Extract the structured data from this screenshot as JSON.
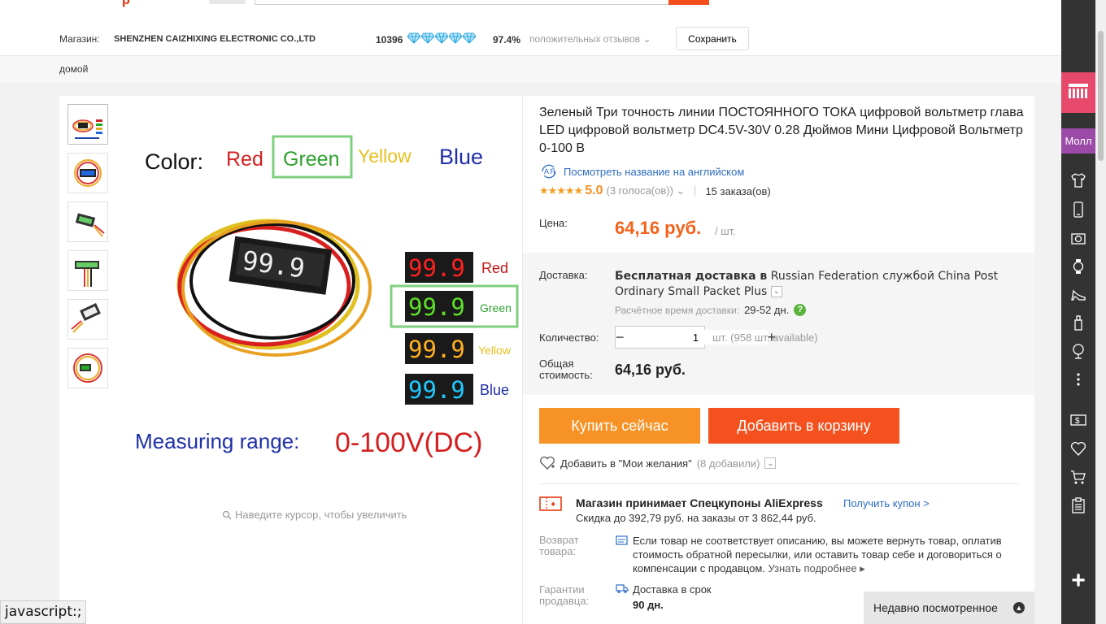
{
  "header": {
    "logo_fragment": "р"
  },
  "store": {
    "label": "Магазин:",
    "name": "SHENZHEN CAIZHIXING ELECTRONIC CO.,LTD",
    "score": "10396",
    "positive_percent": "97.4%",
    "feedback_label": "положительных отзывов",
    "save_label": "Сохранить",
    "diamond_count": 5,
    "diamond_color": "#2aa8e0"
  },
  "breadcrumb": {
    "home": "домой"
  },
  "gallery": {
    "thumbnails": [
      "thumb-1",
      "thumb-2",
      "thumb-3",
      "thumb-4",
      "thumb-5",
      "thumb-6"
    ],
    "image": {
      "color_label": "Color:",
      "colors": [
        "Red",
        "Green",
        "Yellow",
        "Blue"
      ],
      "display_digits": "99.9",
      "range_label": "Measuring range:",
      "range_value": "0-100V(DC)"
    },
    "zoom_hint": "Наведите курсор, чтобы увеличить"
  },
  "product": {
    "title": "Зеленый Три точность линии ПОСТОЯННОГО ТОКА цифровой вольтметр глава LED цифровой вольтметр DC4.5V-30V 0.28 Дюймов Мини Цифровой Вольтметр 0-100 В",
    "translate_link": "Посмотреть название на английском",
    "rating_value": "5.0",
    "rating_stars": "★★★★★",
    "votes": "(3 голоса(ов))",
    "orders": "15 заказа(ов)",
    "price_label": "Цена:",
    "price": "64,16 руб.",
    "price_unit": "/ шт."
  },
  "shipping": {
    "label": "Доставка:",
    "text_bold": "Бесплатная доставка в",
    "text_rest": "Russian Federation службой China Post Ordinary Small Packet Plus",
    "est_label": "Расчётное время доставки:",
    "est_value": "29-52 дн.",
    "qty_label": "Количество:",
    "qty_minus": "−",
    "qty_value": "1",
    "qty_plus": "+",
    "available": "шт. (958 шт. available)",
    "total_label": "Общая стоимость:",
    "total_value": "64,16 руб."
  },
  "actions": {
    "buy_now": "Купить сейчас",
    "add_to_cart": "Добавить в корзину",
    "wishlist": "Добавить в \"Мои желания\"",
    "wishlist_count": "(8 добавили)"
  },
  "coupon": {
    "title": "Магазин принимает Спецкупоны AliExpress",
    "link": "Получить купон >",
    "subtitle": "Скидка до 392,79 руб. на заказы от 3 862,44 руб."
  },
  "returns": {
    "label": "Возврат товара:",
    "text": "Если товар не соответствует описанию, вы можете вернуть товар, оплатив стоимость обратной пересылки, или оставить товар себе и договориться о компенсации с продавцом.",
    "more": "Узнать подробнее ▸"
  },
  "guarantee": {
    "label": "Гарантии продавца:",
    "text": "Доставка в срок",
    "days": "90 дн."
  },
  "recently_viewed": {
    "label": "Недавно посмотренное"
  },
  "status_bar": {
    "text": "javascript:;"
  },
  "sidebar": {
    "mall_label": "Молл",
    "plus": "+"
  },
  "colors": {
    "accent_orange": "#f4621a",
    "buy_button": "#f79326",
    "cart_button": "#f4511e",
    "link_blue": "#2d6cc0",
    "sidebar_bg": "#333333"
  }
}
